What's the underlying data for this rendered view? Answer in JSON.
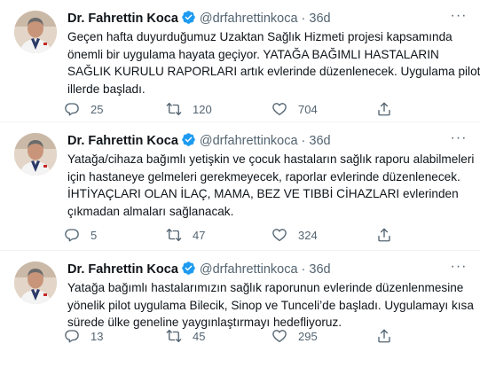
{
  "tweets": [
    {
      "name": "Dr. Fahrettin Koca",
      "handle": "@drfahrettinkoca",
      "sep": "·",
      "time": "36d",
      "lines": [
        "Geçen hafta duyurduğumuz Uzaktan Sağlık Hizmeti projesi kapsamında",
        "önemli bir uygulama hayata geçiyor. YATAĞA BAĞIMLI HASTALARIN",
        "SAĞLIK KURULU RAPORLARI artık evlerinde düzenlenecek. Uygulama pilot",
        "illerde başladı."
      ],
      "replies": "25",
      "retweets": "120",
      "likes": "704"
    },
    {
      "name": "Dr. Fahrettin Koca",
      "handle": "@drfahrettinkoca",
      "sep": "·",
      "time": "36d",
      "lines": [
        "Yatağa/cihaza bağımlı yetişkin ve çocuk hastaların sağlık raporu alabilmeleri",
        "için hastaneye gelmeleri gerekmeyecek, raporlar evlerinde düzenlenecek.",
        "İHTİYAÇLARI OLAN İLAÇ, MAMA, BEZ VE TIBBİ CİHAZLARI evlerinden",
        "çıkmadan almaları sağlanacak."
      ],
      "replies": "5",
      "retweets": "47",
      "likes": "324"
    },
    {
      "name": "Dr. Fahrettin Koca",
      "handle": "@drfahrettinkoca",
      "sep": "·",
      "time": "36d",
      "lines": [
        "Yatağa bağımlı hastalarımızın sağlık raporunun evlerinde düzenlenmesine",
        "yönelik pilot uygulama Bilecik, Sinop ve Tunceli’de başladı. Uygulamayı kısa",
        "sürede ülke geneline yaygınlaştırmayı hedefliyoruz."
      ],
      "replies": "13",
      "retweets": "45",
      "likes": "295"
    }
  ],
  "colors": {
    "verified": "#1d9bf0",
    "muted": "#536471",
    "text": "#0f1419",
    "divider": "#eff3f4"
  },
  "icons": {
    "verified": "verified-badge-icon",
    "more": "more-horizontal-icon",
    "reply": "reply-icon",
    "retweet": "retweet-icon",
    "like": "heart-icon",
    "share": "share-icon"
  }
}
